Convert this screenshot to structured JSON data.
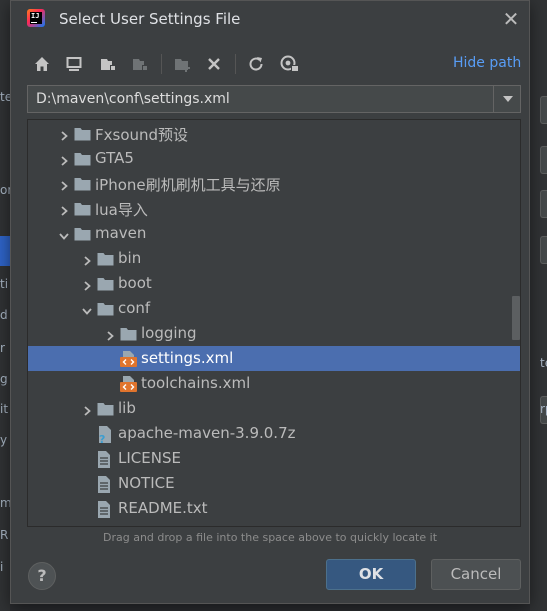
{
  "background": {
    "left_fragments": [
      "te",
      "or",
      "ti",
      "d",
      "r",
      "g",
      "it",
      "y",
      "m",
      "R",
      "i"
    ],
    "right_fragments": [
      "te",
      "rp"
    ]
  },
  "dialog": {
    "title": "Select User Settings File",
    "close_glyph": "✕",
    "toolbar": {
      "icons": [
        "home-icon",
        "desktop-icon",
        "project-icon",
        "module-icon",
        "new-folder-icon",
        "delete-icon",
        "refresh-icon",
        "show-hidden-icon"
      ],
      "hide_path_label": "Hide path"
    },
    "path": {
      "value": "D:\\maven\\conf\\settings.xml"
    },
    "tree": {
      "items": [
        {
          "label": "Fxsound预设",
          "type": "folder",
          "depth": 0,
          "expanded": false
        },
        {
          "label": "GTA5",
          "type": "folder",
          "depth": 0,
          "expanded": false
        },
        {
          "label": "iPhone刷机刷机工具与还原",
          "type": "folder",
          "depth": 0,
          "expanded": false
        },
        {
          "label": "lua导入",
          "type": "folder",
          "depth": 0,
          "expanded": false
        },
        {
          "label": "maven",
          "type": "folder",
          "depth": 0,
          "expanded": true
        },
        {
          "label": "bin",
          "type": "folder",
          "depth": 1,
          "expanded": false
        },
        {
          "label": "boot",
          "type": "folder",
          "depth": 1,
          "expanded": false
        },
        {
          "label": "conf",
          "type": "folder",
          "depth": 1,
          "expanded": true
        },
        {
          "label": "logging",
          "type": "folder",
          "depth": 2,
          "expanded": false
        },
        {
          "label": "settings.xml",
          "type": "xml",
          "depth": 2,
          "selected": true
        },
        {
          "label": "toolchains.xml",
          "type": "xml",
          "depth": 2
        },
        {
          "label": "lib",
          "type": "folder",
          "depth": 1,
          "expanded": false
        },
        {
          "label": "apache-maven-3.9.0.7z",
          "type": "unknown",
          "depth": 1
        },
        {
          "label": "LICENSE",
          "type": "text",
          "depth": 1
        },
        {
          "label": "NOTICE",
          "type": "text",
          "depth": 1
        },
        {
          "label": "README.txt",
          "type": "text",
          "depth": 1
        }
      ]
    },
    "hint": "Drag and drop a file into the space above to quickly locate it",
    "help_label": "?",
    "ok_label": "OK",
    "cancel_label": "Cancel"
  },
  "colors": {
    "dialog_bg": "#3c3f41",
    "selection": "#4b6eaf",
    "link": "#589df6",
    "ok_button": "#365880",
    "folder": "#9aa7b0",
    "xml_icon": "#e0742d"
  }
}
